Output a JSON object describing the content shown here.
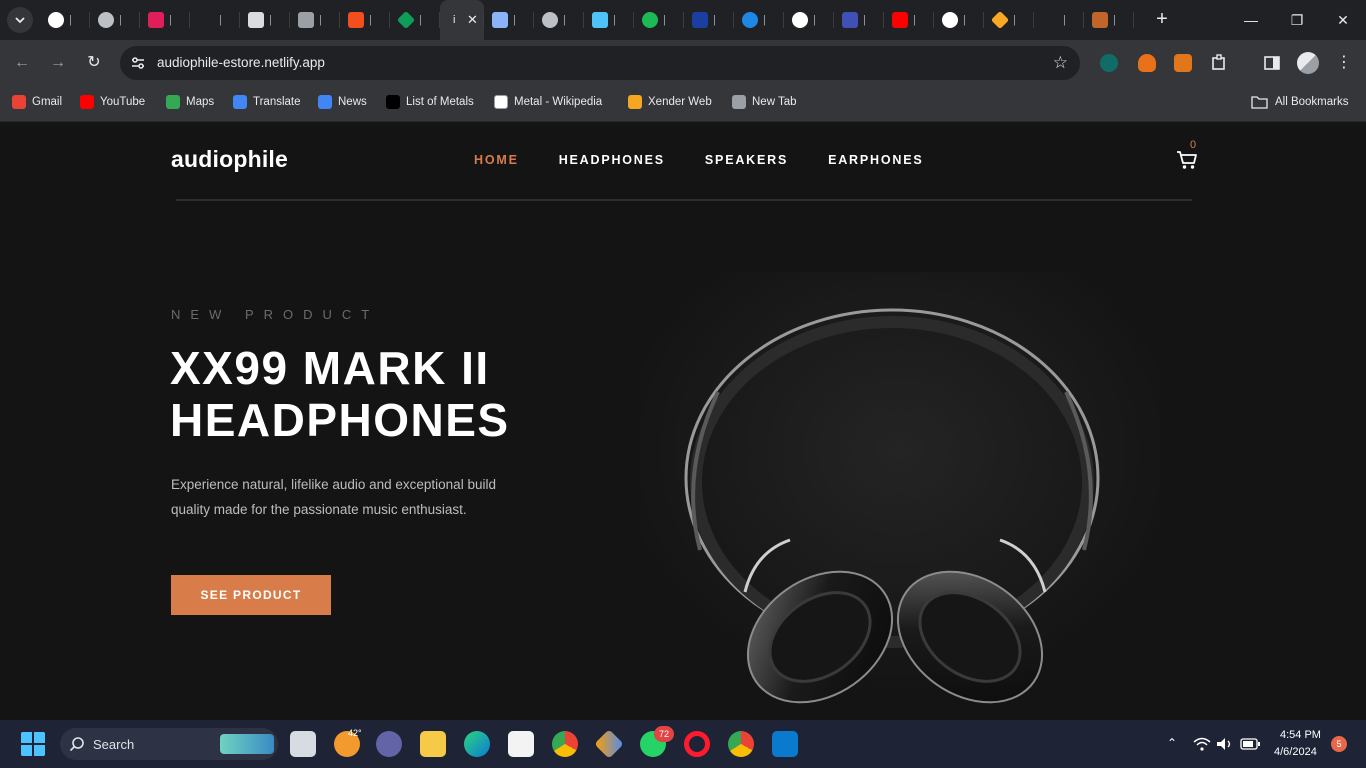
{
  "browser": {
    "tabs": [
      {
        "icon": "github-icon",
        "color": "#ffffff"
      },
      {
        "icon": "globe-icon",
        "color": "#bdc1c6"
      },
      {
        "icon": "slack-icon",
        "color": "#e01e5a"
      },
      {
        "icon": "blank-tab-icon",
        "color": "#202124"
      },
      {
        "icon": "page-icon",
        "color": "#dadce0"
      },
      {
        "icon": "page-icon",
        "color": "#9aa0a6"
      },
      {
        "icon": "figma-icon",
        "color": "#f24e1e"
      },
      {
        "icon": "diamond-icon",
        "color": "#0f9d58"
      },
      {
        "icon": "active-tab-icon",
        "color": "#35363a"
      },
      {
        "icon": "plus-cross-icon",
        "color": "#8ab4f8"
      },
      {
        "icon": "globe-icon",
        "color": "#bdc1c6"
      },
      {
        "icon": "wave-icon",
        "color": "#4fc3f7"
      },
      {
        "icon": "green-dot-icon",
        "color": "#1db954"
      },
      {
        "icon": "flag-icon",
        "color": "#1a3fa0"
      },
      {
        "icon": "circle-blue-icon",
        "color": "#1e88e5"
      },
      {
        "icon": "circle-white-icon",
        "color": "#ffffff"
      },
      {
        "icon": "square-blue-icon",
        "color": "#3f51b5"
      },
      {
        "icon": "youtube-icon",
        "color": "#ff0000"
      },
      {
        "icon": "github-icon",
        "color": "#ffffff"
      },
      {
        "icon": "diamond-orange-icon",
        "color": "#f9a825"
      },
      {
        "icon": "blank-tab-icon",
        "color": "#202124"
      },
      {
        "icon": "orange-square-icon",
        "color": "#c1652a"
      }
    ],
    "url": "audiophile-estore.netlify.app",
    "bookmarks": [
      {
        "label": "Gmail",
        "color": "#ea4335"
      },
      {
        "label": "YouTube",
        "color": "#ff0000"
      },
      {
        "label": "Maps",
        "color": "#34a853"
      },
      {
        "label": "Translate",
        "color": "#4285f4"
      },
      {
        "label": "News",
        "color": "#4285f4"
      },
      {
        "label": "List of Metals",
        "color": "#000000"
      },
      {
        "label": "Metal - Wikipedia",
        "color": "#ffffff"
      },
      {
        "label": "Xender Web",
        "color": "#f5a623"
      },
      {
        "label": "New Tab",
        "color": "#9aa0a6"
      }
    ],
    "all_bookmarks": "All Bookmarks"
  },
  "site": {
    "logo": "audiophile",
    "nav": [
      "HOME",
      "HEADPHONES",
      "SPEAKERS",
      "EARPHONES"
    ],
    "cart_count": "0",
    "hero": {
      "overline": "NEW PRODUCT",
      "title": "XX99 MARK II HEADPHONES",
      "description": "Experience natural, lifelike audio and exceptional build quality made for the passionate music enthusiast.",
      "cta": "SEE PRODUCT"
    },
    "accent": "#d87d4a"
  },
  "taskbar": {
    "search": "Search",
    "weather": "42°",
    "whatsapp_badge": "72",
    "time": "4:54 PM",
    "date": "4/6/2024",
    "notification_count": "5"
  }
}
